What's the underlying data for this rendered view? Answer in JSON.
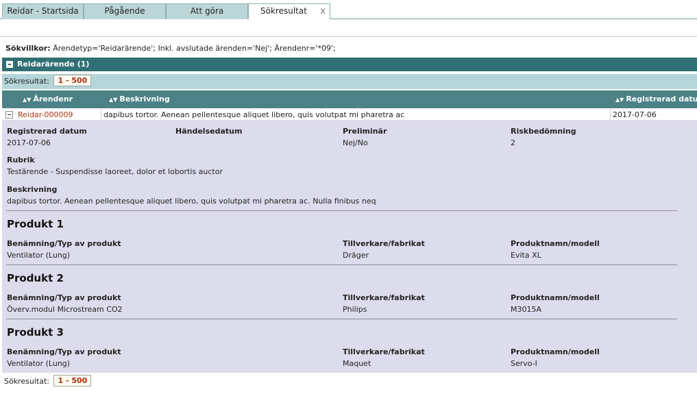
{
  "tabs": [
    {
      "label": "Reidar - Startsida"
    },
    {
      "label": "Pågående"
    },
    {
      "label": "Att göra"
    },
    {
      "label": "Sökresultat",
      "close": "x"
    }
  ],
  "criteria": {
    "label": "Sökvillkor:",
    "value": "Ärendetyp='Reidarärende'; Inkl. avslutade ärenden='Nej'; Ärendenr='*09';"
  },
  "group": {
    "title": "Reidarärende (1)"
  },
  "results": {
    "label": "Sökresultat:",
    "range": "1 - 500"
  },
  "columns": {
    "arendenr": "Ärendenr",
    "beskrivning": "Beskrivning",
    "registrerad": "Registrerad datum"
  },
  "row": {
    "arendenr": "Reidar-000009",
    "beskrivning": "dapibus tortor. Aenean pellentesque aliquet libero, quis volutpat mi pharetra ac",
    "registrerad": "2017-07-06"
  },
  "detail": {
    "registrerad_label": "Registrerad datum",
    "registrerad_value": "2017-07-06",
    "handelse_label": "Händelsedatum",
    "preliminar_label": "Preliminär",
    "preliminar_value": "Nej/No",
    "risk_label": "Riskbedömning",
    "risk_value": "2",
    "rubrik_label": "Rubrik",
    "rubrik_value": "Testärende - Suspendisse laoreet, dolor et lobortis auctor",
    "beskrivning_label": "Beskrivning",
    "beskrivning_value": "dapibus tortor. Aenean pellentesque aliquet libero, quis volutpat mi pharetra ac. Nulla finibus neq"
  },
  "products": [
    {
      "title": "Produkt 1",
      "typ_label": "Benämning/Typ av produkt",
      "typ": "Ventilator (Lung)",
      "tillv_label": "Tillverkare/fabrikat",
      "tillv": "Dräger",
      "modell_label": "Produktnamn/modell",
      "modell": "Evita XL"
    },
    {
      "title": "Produkt 2",
      "typ_label": "Benämning/Typ av produkt",
      "typ": "Överv.modul Microstream CO2",
      "tillv_label": "Tillverkare/fabrikat",
      "tillv": "Philips",
      "modell_label": "Produktnamn/modell",
      "modell": "M3015A"
    },
    {
      "title": "Produkt 3",
      "typ_label": "Benämning/Typ av produkt",
      "typ": "Ventilator (Lung)",
      "tillv_label": "Tillverkare/fabrikat",
      "tillv": "Maquet",
      "modell_label": "Produktnamn/modell",
      "modell": "Servo-I"
    }
  ],
  "footer": {
    "label": "Sökresultat:",
    "range": "1 - 500"
  },
  "colors": {
    "header_dark": "#306f73",
    "header_mid": "#4c8286",
    "results_bar": "#b4d6d8",
    "detail_bg": "#dcdced",
    "link": "#b23010"
  }
}
